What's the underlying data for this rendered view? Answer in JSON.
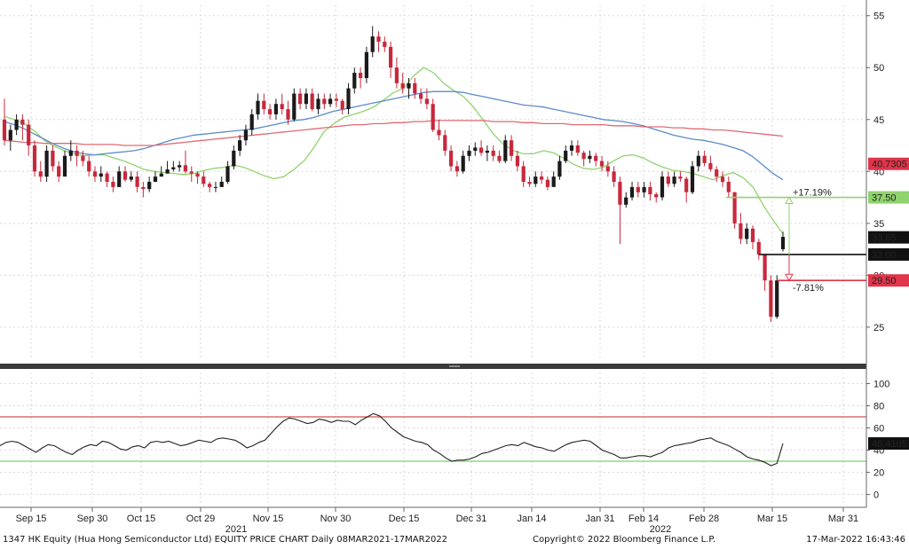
{
  "footer": {
    "left": "1347 HK Equity (Hua Hong Semiconductor Ltd) EQUITY PRICE CHART  Daily 08MAR2021-17MAR2022",
    "center": "Copyright© 2022 Bloomberg Finance L.P.",
    "right": "17-Mar-2022 16:43:46"
  },
  "colors": {
    "up": "#1a1a1a",
    "down": "#c8283c",
    "ma_green": "#8fd36c",
    "ma_blue": "#5b8bc9",
    "ma_red": "#e06a74",
    "grid": "#d9d9d9",
    "rsi_upper": "#d05050",
    "rsi_lower": "#7ad36a"
  },
  "chart_data": [
    {
      "type": "candlestick",
      "title": "",
      "ylim": [
        22,
        56
      ],
      "yticks": [
        25,
        30,
        35,
        40,
        45,
        50,
        55
      ],
      "x_axis_labels": [
        "Sep 15",
        "Sep 30",
        "Oct 15",
        "Oct 29",
        "Nov 15",
        "Nov 30",
        "Dec 15",
        "Dec 31",
        "Jan 14",
        "Jan 31",
        "Feb 14",
        "Feb 28",
        "Mar 15",
        "Mar 31"
      ],
      "x_year_labels": [
        "2021",
        "2022"
      ],
      "candles": [
        [
          45.0,
          43.0,
          47.0,
          42.5
        ],
        [
          43.0,
          44.0,
          44.5,
          42.0
        ],
        [
          44.0,
          45.0,
          45.5,
          43.5
        ],
        [
          45.0,
          44.5,
          45.5,
          43.0
        ],
        [
          44.5,
          42.5,
          45.0,
          41.5
        ],
        [
          42.5,
          40.0,
          43.0,
          39.5
        ],
        [
          40.0,
          39.5,
          41.0,
          39.0
        ],
        [
          39.5,
          42.0,
          42.5,
          39.0
        ],
        [
          42.0,
          40.5,
          42.5,
          40.0
        ],
        [
          40.5,
          39.5,
          41.0,
          39.0
        ],
        [
          39.5,
          41.5,
          42.0,
          39.5
        ],
        [
          41.5,
          42.0,
          43.0,
          41.0
        ],
        [
          42.0,
          41.5,
          42.5,
          40.5
        ],
        [
          41.5,
          41.0,
          42.0,
          40.5
        ],
        [
          41.0,
          40.0,
          41.5,
          39.5
        ],
        [
          40.0,
          39.5,
          40.5,
          39.0
        ],
        [
          39.5,
          39.8,
          40.5,
          39.0
        ],
        [
          39.8,
          39.0,
          40.0,
          38.5
        ],
        [
          39.0,
          38.5,
          39.5,
          38.0
        ],
        [
          38.5,
          40.0,
          40.5,
          38.5
        ],
        [
          40.0,
          39.2,
          40.5,
          39.0
        ],
        [
          39.2,
          39.5,
          40.0,
          39.0
        ],
        [
          39.5,
          38.5,
          40.0,
          38.0
        ],
        [
          38.5,
          38.3,
          39.0,
          37.5
        ],
        [
          38.3,
          39.0,
          39.5,
          38.0
        ],
        [
          39.0,
          39.5,
          40.0,
          39.0
        ],
        [
          39.5,
          39.8,
          40.5,
          39.5
        ],
        [
          39.8,
          40.2,
          41.0,
          39.8
        ],
        [
          40.2,
          40.4,
          41.0,
          40.0
        ],
        [
          40.4,
          40.6,
          41.0,
          40.0
        ],
        [
          40.6,
          40.0,
          42.0,
          39.8
        ],
        [
          40.0,
          39.8,
          40.5,
          39.0
        ],
        [
          39.8,
          39.5,
          40.0,
          38.8
        ],
        [
          39.5,
          38.8,
          40.0,
          38.5
        ],
        [
          38.8,
          38.5,
          39.0,
          38.0
        ],
        [
          38.5,
          38.5,
          39.0,
          38.0
        ],
        [
          38.5,
          39.0,
          39.5,
          38.5
        ],
        [
          39.0,
          40.5,
          41.0,
          38.8
        ],
        [
          40.5,
          42.0,
          42.5,
          40.2
        ],
        [
          42.0,
          43.0,
          43.5,
          41.5
        ],
        [
          43.0,
          44.0,
          44.5,
          42.5
        ],
        [
          44.0,
          45.5,
          46.0,
          43.5
        ],
        [
          45.5,
          46.8,
          47.5,
          45.0
        ],
        [
          46.8,
          46.0,
          47.5,
          45.5
        ],
        [
          46.0,
          45.5,
          46.5,
          45.0
        ],
        [
          45.5,
          46.5,
          47.0,
          45.0
        ],
        [
          46.5,
          46.0,
          47.5,
          45.5
        ],
        [
          46.0,
          45.0,
          46.8,
          44.5
        ],
        [
          45.0,
          47.5,
          48.0,
          44.8
        ],
        [
          47.5,
          46.5,
          48.0,
          46.0
        ],
        [
          46.5,
          47.5,
          48.0,
          46.0
        ],
        [
          47.5,
          46.0,
          48.0,
          45.8
        ],
        [
          46.0,
          47.0,
          47.5,
          45.5
        ],
        [
          47.0,
          46.5,
          47.5,
          46.0
        ],
        [
          46.5,
          47.0,
          47.5,
          46.2
        ],
        [
          47.0,
          46.8,
          47.5,
          46.2
        ],
        [
          46.8,
          46.0,
          47.0,
          45.5
        ],
        [
          46.0,
          48.0,
          48.5,
          45.5
        ],
        [
          48.0,
          49.5,
          50.0,
          47.5
        ],
        [
          49.5,
          49.0,
          50.0,
          48.0
        ],
        [
          49.0,
          51.5,
          52.0,
          48.5
        ],
        [
          51.5,
          53.0,
          54.0,
          51.0
        ],
        [
          53.0,
          52.5,
          53.5,
          51.5
        ],
        [
          52.5,
          52.0,
          53.0,
          51.5
        ],
        [
          52.0,
          50.0,
          52.5,
          49.0
        ],
        [
          50.0,
          48.5,
          51.0,
          48.0
        ],
        [
          48.5,
          48.0,
          49.5,
          47.5
        ],
        [
          48.0,
          48.5,
          49.0,
          47.0
        ],
        [
          48.5,
          47.5,
          49.0,
          47.0
        ],
        [
          47.5,
          47.0,
          48.0,
          46.5
        ],
        [
          47.0,
          46.5,
          48.0,
          46.0
        ],
        [
          46.5,
          44.0,
          47.0,
          43.8
        ],
        [
          44.0,
          43.5,
          45.0,
          43.0
        ],
        [
          43.5,
          42.0,
          44.0,
          41.5
        ],
        [
          42.0,
          40.5,
          42.5,
          40.0
        ],
        [
          40.5,
          40.0,
          41.0,
          39.5
        ],
        [
          40.0,
          41.5,
          42.0,
          39.8
        ],
        [
          41.5,
          42.0,
          42.5,
          41.0
        ],
        [
          42.0,
          42.3,
          42.8,
          41.5
        ],
        [
          42.3,
          41.8,
          43.0,
          41.5
        ],
        [
          41.8,
          42.0,
          42.5,
          41.0
        ],
        [
          42.0,
          41.5,
          42.5,
          41.0
        ],
        [
          41.5,
          41.0,
          42.0,
          40.8
        ],
        [
          41.0,
          43.0,
          43.5,
          40.8
        ],
        [
          43.0,
          41.5,
          43.5,
          41.0
        ],
        [
          41.5,
          40.5,
          42.0,
          40.0
        ],
        [
          40.5,
          39.0,
          41.0,
          38.5
        ],
        [
          39.0,
          38.8,
          39.5,
          38.5
        ],
        [
          38.8,
          39.5,
          40.0,
          38.5
        ],
        [
          39.5,
          39.2,
          40.0,
          38.8
        ],
        [
          39.2,
          38.5,
          39.5,
          38.2
        ],
        [
          38.5,
          39.5,
          40.0,
          38.5
        ],
        [
          39.5,
          41.0,
          41.5,
          39.2
        ],
        [
          41.0,
          42.0,
          42.5,
          40.8
        ],
        [
          42.0,
          42.5,
          43.0,
          41.5
        ],
        [
          42.5,
          41.8,
          43.0,
          41.5
        ],
        [
          41.8,
          41.2,
          42.0,
          40.5
        ],
        [
          41.2,
          41.5,
          42.0,
          40.8
        ],
        [
          41.5,
          41.0,
          41.8,
          40.5
        ],
        [
          41.0,
          40.5,
          41.5,
          40.0
        ],
        [
          40.5,
          40.0,
          41.0,
          39.5
        ],
        [
          40.0,
          39.0,
          40.5,
          38.5
        ],
        [
          39.0,
          36.8,
          39.5,
          33.0
        ],
        [
          36.8,
          37.5,
          38.0,
          36.5
        ],
        [
          37.5,
          38.5,
          39.0,
          37.2
        ],
        [
          38.5,
          38.0,
          39.0,
          37.5
        ],
        [
          38.0,
          38.5,
          39.0,
          37.5
        ],
        [
          38.5,
          37.8,
          39.0,
          37.2
        ],
        [
          37.8,
          37.5,
          38.0,
          37.0
        ],
        [
          37.5,
          39.5,
          40.0,
          37.2
        ],
        [
          39.5,
          38.8,
          40.0,
          38.5
        ],
        [
          38.8,
          39.5,
          40.0,
          38.5
        ],
        [
          39.5,
          39.3,
          40.0,
          39.0
        ],
        [
          39.3,
          38.0,
          39.5,
          37.0
        ],
        [
          38.0,
          40.5,
          41.0,
          37.8
        ],
        [
          40.5,
          41.5,
          42.0,
          40.0
        ],
        [
          41.5,
          40.8,
          42.0,
          40.5
        ],
        [
          40.8,
          40.2,
          41.5,
          40.0
        ],
        [
          40.2,
          39.5,
          40.5,
          39.0
        ],
        [
          39.5,
          39.0,
          40.0,
          38.5
        ],
        [
          39.0,
          38.0,
          39.5,
          37.5
        ],
        [
          38.0,
          35.0,
          38.0,
          34.5
        ],
        [
          35.0,
          33.5,
          36.0,
          33.0
        ],
        [
          33.5,
          34.5,
          35.0,
          33.0
        ],
        [
          34.5,
          33.2,
          34.8,
          32.5
        ],
        [
          33.2,
          32.0,
          33.5,
          31.5
        ],
        [
          32.0,
          29.5,
          32.0,
          28.5
        ],
        [
          29.5,
          26.0,
          30.0,
          25.5
        ],
        [
          26.0,
          29.5,
          30.0,
          25.8
        ],
        [
          32.5,
          33.7,
          34.2,
          32.3
        ]
      ],
      "moving_averages": [
        {
          "name": "",
          "color": "ma_green",
          "values": [
            45.3,
            45.0,
            44.6,
            43.9,
            43.0,
            42.4,
            42.0,
            41.7,
            41.5,
            41.6,
            41.6,
            41.3,
            41.0,
            40.6,
            40.2,
            40.0,
            39.9,
            39.8,
            39.7,
            39.8,
            40.1,
            40.3,
            40.4,
            40.6,
            40.4,
            40.0,
            39.6,
            39.3,
            39.5,
            40.2,
            41.0,
            42.3,
            43.8,
            44.6,
            45.2,
            45.5,
            45.8,
            46.2,
            46.9,
            47.6,
            48.0,
            49.2,
            50.0,
            49.5,
            48.5,
            47.8,
            47.2,
            46.2,
            44.9,
            43.6,
            42.6,
            42.0,
            41.7,
            41.7,
            42.0,
            41.8,
            41.3,
            40.7,
            40.3,
            40.2,
            40.4,
            41.0,
            41.5,
            41.6,
            41.3,
            40.8,
            40.4,
            40.1,
            40.0,
            39.8,
            39.5,
            39.2,
            39.6,
            39.9,
            39.4,
            38.5,
            36.8,
            35.3,
            34.0
          ]
        },
        {
          "name": "",
          "color": "ma_blue",
          "values": [
            44.8,
            44.5,
            44.1,
            43.6,
            43.1,
            42.6,
            42.2,
            41.9,
            41.7,
            41.6,
            41.7,
            41.8,
            41.9,
            42.0,
            42.2,
            42.5,
            42.8,
            43.1,
            43.3,
            43.5,
            43.6,
            43.7,
            43.8,
            43.9,
            44.0,
            44.1,
            44.3,
            44.5,
            44.7,
            44.9,
            45.0,
            45.2,
            45.5,
            45.8,
            46.0,
            46.2,
            46.4,
            46.6,
            46.8,
            47.0,
            47.2,
            47.4,
            47.6,
            47.7,
            47.7,
            47.7,
            47.6,
            47.4,
            47.2,
            47.0,
            46.8,
            46.6,
            46.4,
            46.3,
            46.2,
            46.0,
            45.8,
            45.6,
            45.4,
            45.2,
            45.0,
            44.9,
            44.8,
            44.6,
            44.4,
            44.1,
            43.8,
            43.5,
            43.3,
            43.1,
            43.0,
            42.8,
            42.6,
            42.3,
            42.0,
            41.4,
            40.6,
            39.8,
            39.2
          ]
        },
        {
          "name": "",
          "color": "ma_red",
          "values": [
            43.0,
            42.9,
            42.8,
            42.8,
            42.7,
            42.7,
            42.7,
            42.7,
            42.6,
            42.6,
            42.6,
            42.6,
            42.5,
            42.5,
            42.5,
            42.5,
            42.6,
            42.7,
            42.8,
            42.9,
            43.0,
            43.1,
            43.2,
            43.3,
            43.4,
            43.5,
            43.6,
            43.7,
            43.8,
            43.9,
            44.0,
            44.1,
            44.2,
            44.3,
            44.4,
            44.5,
            44.5,
            44.6,
            44.6,
            44.7,
            44.7,
            44.8,
            44.8,
            44.9,
            44.9,
            44.9,
            44.9,
            44.9,
            44.9,
            44.8,
            44.8,
            44.8,
            44.7,
            44.7,
            44.6,
            44.6,
            44.6,
            44.5,
            44.5,
            44.5,
            44.5,
            44.4,
            44.4,
            44.4,
            44.3,
            44.3,
            44.3,
            44.2,
            44.2,
            44.1,
            44.1,
            44.0,
            44.0,
            43.9,
            43.8,
            43.7,
            43.6,
            43.5,
            43.4
          ]
        }
      ],
      "price_labels": [
        {
          "value": 40.7305,
          "text": "40.7305",
          "color": "#e0354a"
        },
        {
          "value": 37.5,
          "text": "37.50",
          "color": "#8fd36c"
        },
        {
          "value": 33.65,
          "text": "33.65",
          "color": "#111111"
        },
        {
          "value": 32.0,
          "text": "32.00",
          "color": "#111111"
        },
        {
          "value": 29.5,
          "text": "29.50",
          "color": "#e0354a"
        }
      ],
      "level_lines": [
        {
          "value": 37.5,
          "color": "#8fd36c"
        },
        {
          "value": 32.0,
          "color": "#111111"
        },
        {
          "value": 29.5,
          "color": "#e0354a"
        }
      ],
      "annotations": [
        {
          "text": "+17.19%",
          "color": "#8fd36c",
          "from": 32.0,
          "to": 37.5
        },
        {
          "text": "-7.81%",
          "color": "#e0354a",
          "from": 32.0,
          "to": 29.5
        }
      ]
    },
    {
      "type": "line",
      "title": "",
      "ylim": [
        -10,
        110
      ],
      "yticks": [
        0,
        20,
        40,
        60,
        80,
        100
      ],
      "reference_lines": [
        70,
        30
      ],
      "last_value_label": "46.4105",
      "values": [
        44,
        47,
        48,
        47,
        44,
        41,
        38,
        42,
        45,
        44,
        41,
        38,
        36,
        40,
        43,
        45,
        44,
        48,
        47,
        44,
        41,
        40,
        43,
        44,
        42,
        47,
        48,
        47,
        48,
        46,
        44,
        45,
        47,
        49,
        48,
        47,
        50,
        51,
        50,
        49,
        46,
        42,
        44,
        47,
        49,
        55,
        61,
        66,
        69,
        68,
        66,
        64,
        65,
        68,
        67,
        65,
        67,
        66,
        66,
        63,
        67,
        70,
        73,
        71,
        66,
        60,
        56,
        52,
        50,
        48,
        47,
        45,
        40,
        37,
        33,
        30,
        31,
        31,
        32,
        34,
        37,
        38,
        40,
        42,
        44,
        45,
        44,
        47,
        45,
        43,
        42,
        40,
        39,
        42,
        45,
        47,
        48,
        49,
        48,
        44,
        40,
        38,
        36,
        33,
        33,
        34,
        35,
        35,
        34,
        36,
        38,
        42,
        44,
        45,
        46,
        47,
        49,
        50,
        51,
        48,
        46,
        44,
        41,
        38,
        34,
        32,
        31,
        29,
        26,
        28,
        46
      ]
    }
  ]
}
